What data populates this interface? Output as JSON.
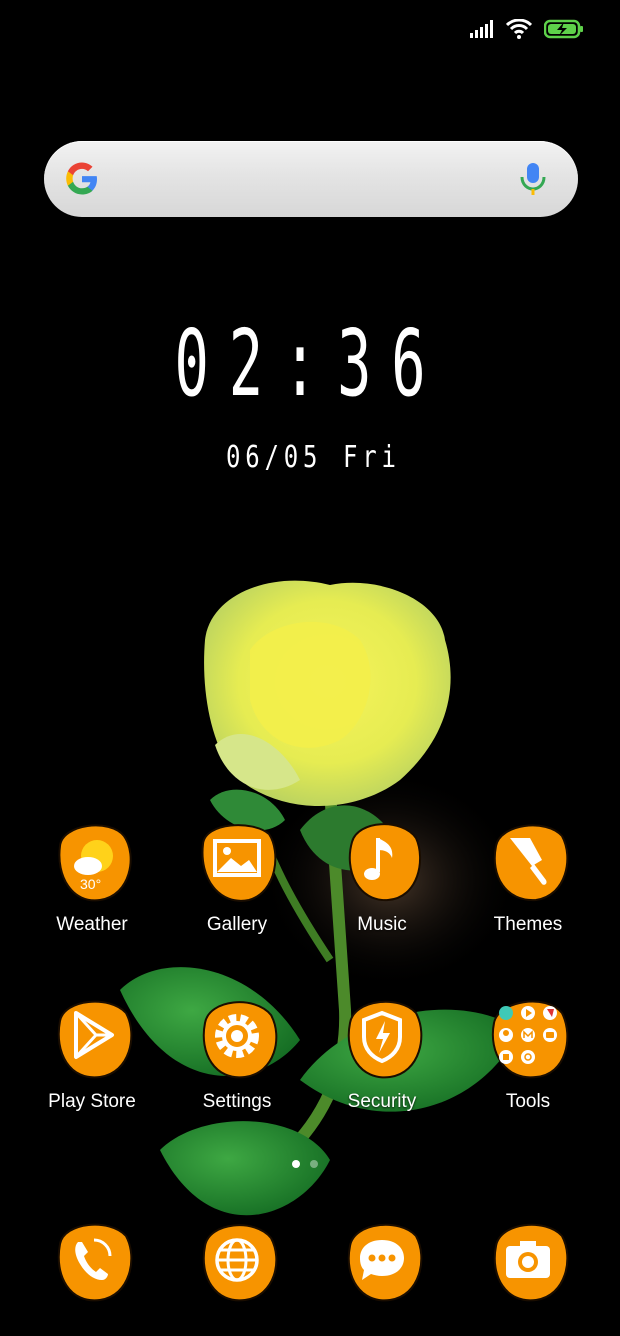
{
  "status_bar": {
    "icons": [
      "signal-icon",
      "wifi-icon",
      "battery-charging-icon"
    ],
    "battery_color": "#5ed14a"
  },
  "search": {
    "placeholder": ""
  },
  "clock": {
    "time": "02:36",
    "date": "06/05",
    "day": "Fri"
  },
  "apps_row1": [
    {
      "label": "Weather",
      "icon": "weather-icon",
      "temp": "30°"
    },
    {
      "label": "Gallery",
      "icon": "gallery-icon"
    },
    {
      "label": "Music",
      "icon": "music-icon"
    },
    {
      "label": "Themes",
      "icon": "themes-icon"
    }
  ],
  "apps_row2": [
    {
      "label": "Play Store",
      "icon": "play-store-icon"
    },
    {
      "label": "Settings",
      "icon": "settings-icon"
    },
    {
      "label": "Security",
      "icon": "security-icon"
    },
    {
      "label": "Tools",
      "icon": "tools-folder-icon"
    }
  ],
  "dock": [
    {
      "icon": "phone-icon"
    },
    {
      "icon": "browser-icon"
    },
    {
      "icon": "messages-icon"
    },
    {
      "icon": "camera-icon"
    }
  ],
  "page_indicator": {
    "pages": 2,
    "current": 1
  },
  "colors": {
    "icon_orange": "#f79400",
    "background": "#000000"
  }
}
